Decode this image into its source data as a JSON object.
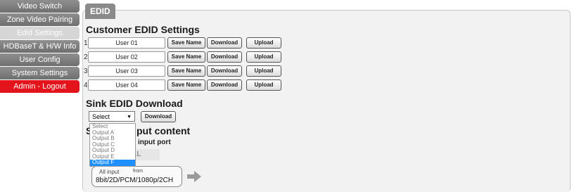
{
  "sidebar": {
    "items": [
      {
        "label": "Video Switch"
      },
      {
        "label": "Zone Video Pairing"
      },
      {
        "label": "Edid Settings"
      },
      {
        "label": "HDBaseT & H/W Info"
      },
      {
        "label": "User Config"
      },
      {
        "label": "System Settings"
      },
      {
        "label": "Admin - Logout"
      }
    ]
  },
  "panel": {
    "tab_label": "EDID"
  },
  "customer": {
    "title": "Customer EDID Settings",
    "rows": [
      {
        "num": "1",
        "name": "User 01"
      },
      {
        "num": "2",
        "name": "User 02"
      },
      {
        "num": "3",
        "name": "User 03"
      },
      {
        "num": "4",
        "name": "User 04"
      }
    ],
    "save_label": "Save Name",
    "download_label": "Download",
    "upload_label": "Upload"
  },
  "sink": {
    "title": "Sink EDID Download",
    "select_value": "Select",
    "download_label": "Download",
    "options": [
      "Select",
      "Output A",
      "Output B",
      "Output C",
      "Output D",
      "Output E",
      "Output F"
    ],
    "selected_index": 6
  },
  "copy": {
    "title_start": "S",
    "title_end": "put content",
    "port_label": "input port",
    "all_label": "ALL",
    "box_line1": "All input",
    "box_from": "from",
    "box_line2": "8bit/2D/PCM/1080p/2CH"
  }
}
